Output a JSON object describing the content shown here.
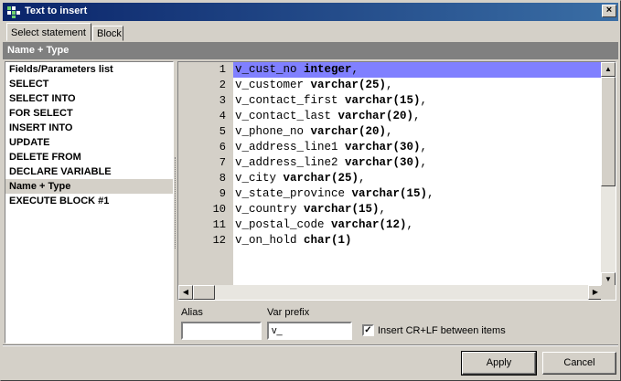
{
  "window": {
    "title": "Text to insert",
    "close_label": "×"
  },
  "tabs": [
    {
      "label": "Select statement",
      "active": true
    },
    {
      "label": "Block",
      "active": false
    }
  ],
  "group_header": "Name + Type",
  "left_list": {
    "items": [
      "Fields/Parameters list",
      "SELECT",
      "SELECT INTO",
      "FOR SELECT",
      "INSERT INTO",
      "UPDATE",
      "DELETE FROM",
      "DECLARE VARIABLE",
      "Name + Type",
      "EXECUTE BLOCK #1"
    ],
    "selected_index": 8
  },
  "editor": {
    "current_line": 1,
    "lines": [
      {
        "num": "1",
        "name": "v_cust_no ",
        "type": "integer",
        "tail": ","
      },
      {
        "num": "2",
        "name": "v_customer ",
        "type": "varchar(25)",
        "tail": ","
      },
      {
        "num": "3",
        "name": "v_contact_first ",
        "type": "varchar(15)",
        "tail": ","
      },
      {
        "num": "4",
        "name": "v_contact_last ",
        "type": "varchar(20)",
        "tail": ","
      },
      {
        "num": "5",
        "name": "v_phone_no ",
        "type": "varchar(20)",
        "tail": ","
      },
      {
        "num": "6",
        "name": "v_address_line1 ",
        "type": "varchar(30)",
        "tail": ","
      },
      {
        "num": "7",
        "name": "v_address_line2 ",
        "type": "varchar(30)",
        "tail": ","
      },
      {
        "num": "8",
        "name": "v_city ",
        "type": "varchar(25)",
        "tail": ","
      },
      {
        "num": "9",
        "name": "v_state_province ",
        "type": "varchar(15)",
        "tail": ","
      },
      {
        "num": "10",
        "name": "v_country ",
        "type": "varchar(15)",
        "tail": ","
      },
      {
        "num": "11",
        "name": "v_postal_code ",
        "type": "varchar(12)",
        "tail": ","
      },
      {
        "num": "12",
        "name": "v_on_hold ",
        "type": "char(1)",
        "tail": ""
      }
    ]
  },
  "fields": {
    "alias_label": "Alias",
    "alias_value": "",
    "prefix_label": "Var prefix",
    "prefix_value": "v_",
    "crlf_label": "Insert CR+LF between items",
    "crlf_checked": true
  },
  "buttons": {
    "apply": "Apply",
    "cancel": "Cancel"
  },
  "colors": {
    "title_bar": "#0a246a",
    "current_line": "#8080ff",
    "face": "#d4d0c8"
  }
}
